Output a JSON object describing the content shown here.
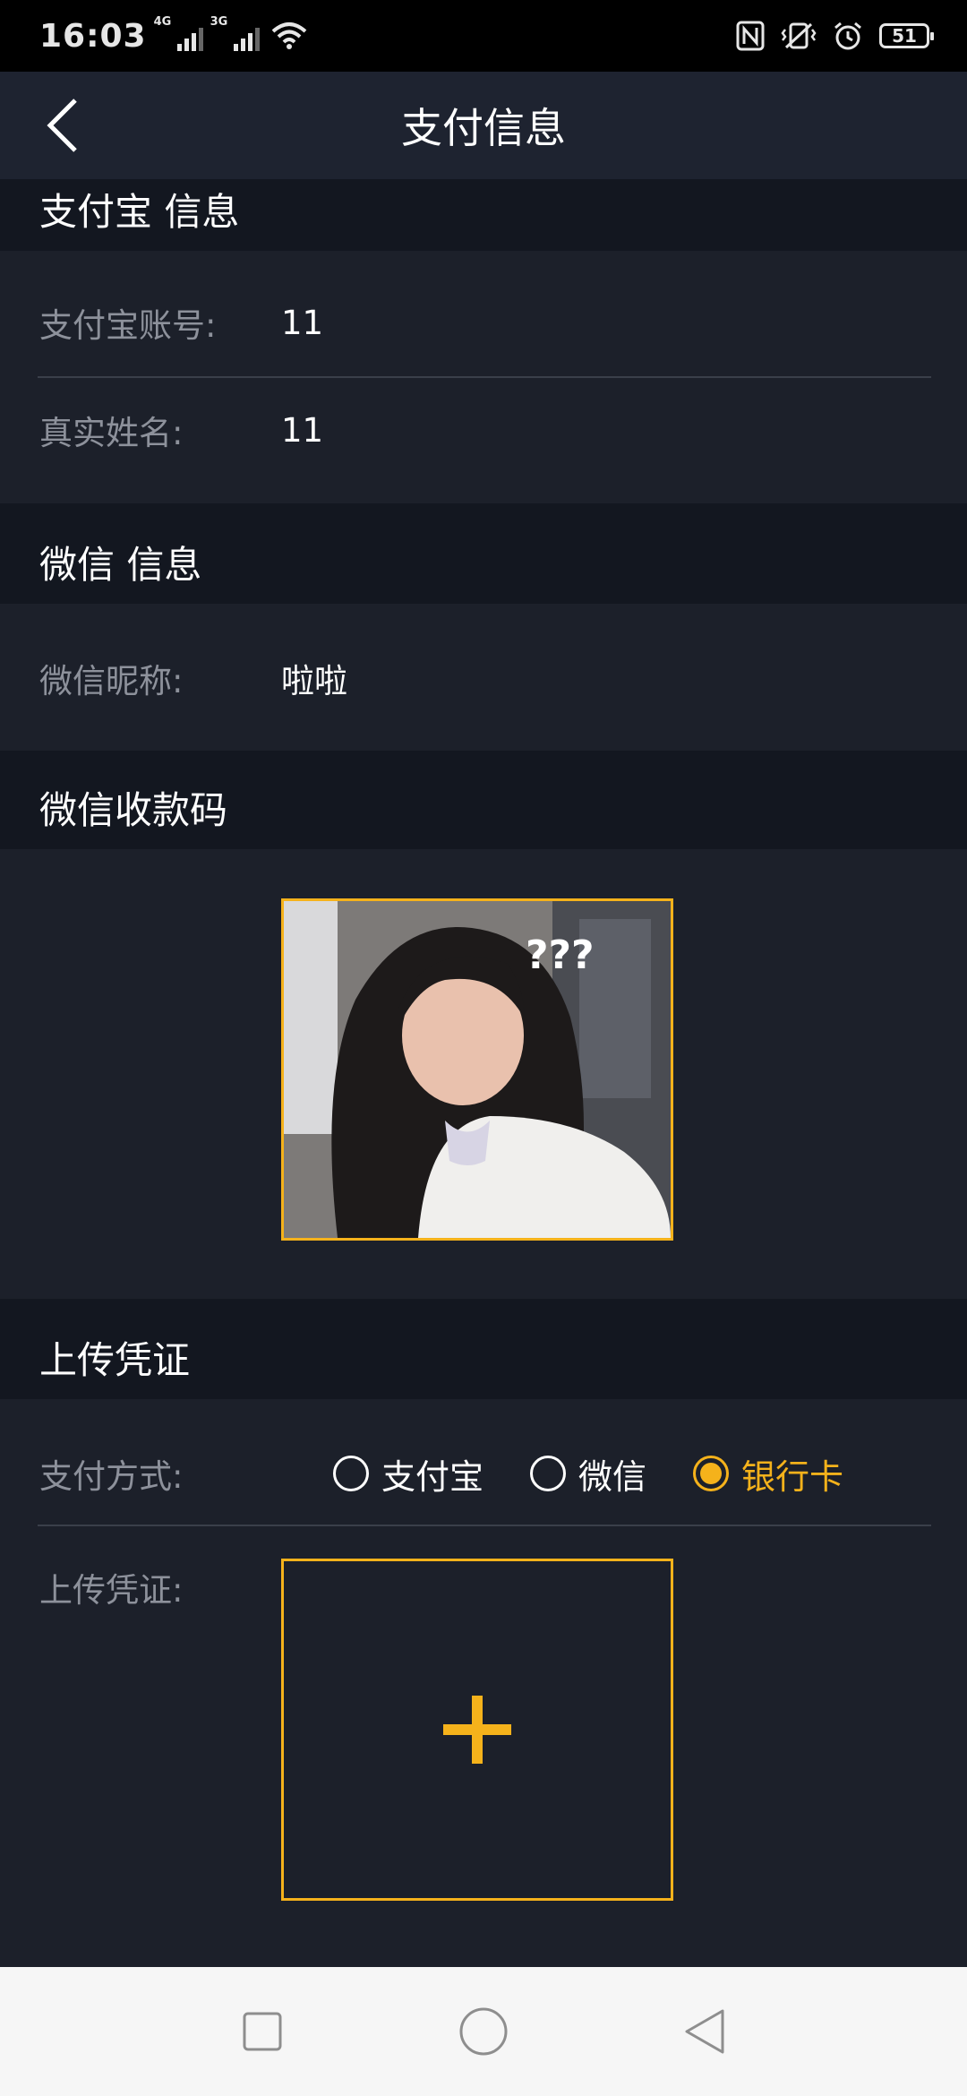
{
  "status_bar": {
    "time": "16:03",
    "signal1_tag": "4G",
    "signal2_tag": "3G",
    "battery": "51"
  },
  "header": {
    "title": "支付信息"
  },
  "alipay": {
    "section_title": "支付宝 信息",
    "account_label": "支付宝账号:",
    "account_value": "11",
    "name_label": "真实姓名:",
    "name_value": "11"
  },
  "wechat": {
    "section_title": "微信 信息",
    "nickname_label": "微信昵称:",
    "nickname_value": "啦啦",
    "qr_section_title": "微信收款码"
  },
  "upload": {
    "section_title": "上传凭证",
    "method_label": "支付方式:",
    "methods": [
      {
        "label": "支付宝",
        "selected": false
      },
      {
        "label": "微信",
        "selected": false
      },
      {
        "label": "银行卡",
        "selected": true
      }
    ],
    "voucher_label": "上传凭证:"
  },
  "colors": {
    "accent": "#f5b21b",
    "background": "#1c202a",
    "section_header": "#131720",
    "label_gray": "#8d919b"
  }
}
